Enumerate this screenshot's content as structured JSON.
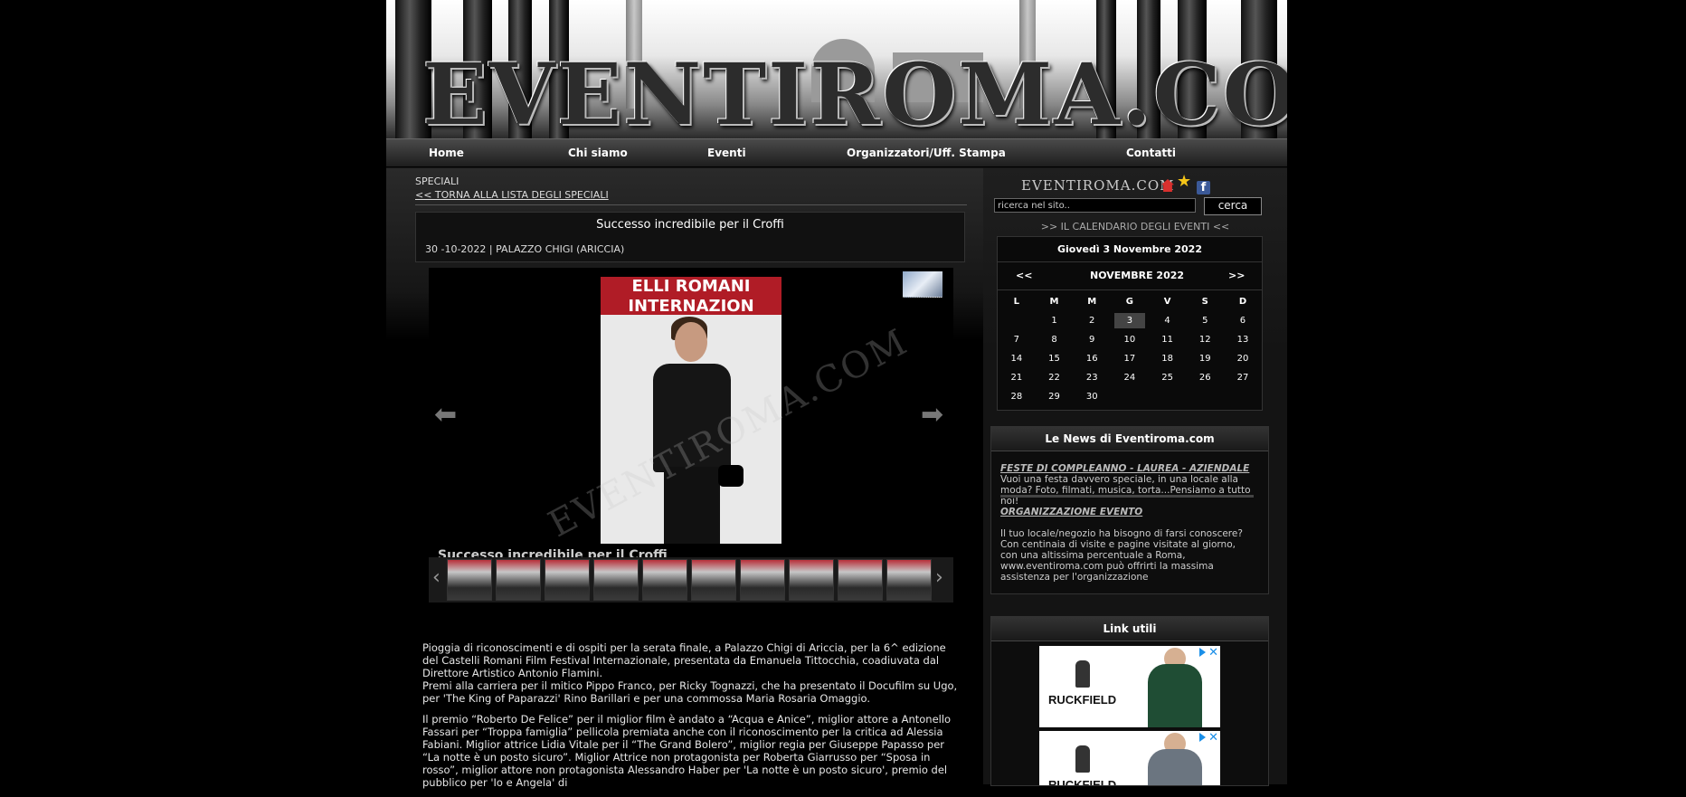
{
  "header": {
    "logo": "EVENTIROMA.COM"
  },
  "nav": {
    "items": [
      "Home",
      "Chi siamo",
      "Eventi",
      "Organizzatori/Uff. Stampa",
      "Contatti"
    ]
  },
  "main": {
    "section_label": "SPECIALI",
    "back_link": "<< TORNA ALLA LISTA DEGLI SPECIALI",
    "article_title": "Successo incredibile per il Croffi",
    "article_meta": "30 -10-2022  |  PALAZZO CHIGI (ARICCIA)",
    "gallery": {
      "banner": "ELLI ROMANI INTERNAZION",
      "watermark": "EVENTIROMA.COM",
      "caption": "Successo incredibile per il Croffi",
      "prev_arrow": "⬅",
      "next_arrow": "➡",
      "thumb_prev": "‹",
      "thumb_next": "›"
    },
    "body": {
      "p1": "Pioggia di riconoscimenti e di ospiti per la serata finale, a Palazzo Chigi di Ariccia, per la 6^ edizione del Castelli Romani Film Festival Internazionale, presentata da Emanuela Tittocchia, coadiuvata dal Direttore Artistico Antonio Flamini.",
      "p2": "Premi alla carriera per il mitico Pippo Franco, per Ricky Tognazzi, che ha presentato il Docufilm su Ugo, per 'The King of Paparazzi' Rino Barillari e per una commossa Maria Rosaria Omaggio.",
      "p3": "Il premio “Roberto De Felice” per il miglior film è andato a “Acqua e Anice”, miglior attore a Antonello Fassari per “Troppa famiglia” pellicola premiata anche con il riconoscimento per la critica ad Alessia Fabiani. Miglior attrice Lidia Vitale per il “The Grand Bolero”, miglior regia per Giuseppe Papasso per “La notte è un posto sicuro”. Miglior Attrice non protagonista per Roberta Giarrusso per “Sposa in rosso”, miglior attore non protagonista Alessandro Haber per 'La notte è un posto sicuro', premio del pubblico per 'Io e Angela' di"
    }
  },
  "sidebar": {
    "logo": "EVENTIROMA.COM",
    "search": {
      "placeholder": "ricerca nel sito..",
      "button": "cerca"
    },
    "calendar_link": ">> IL CALENDARIO DEGLI EVENTI <<",
    "calendar": {
      "current_date": "Giovedì 3 Novembre 2022",
      "prev": "<<",
      "next": ">>",
      "month": "NOVEMBRE 2022",
      "weekdays": [
        "L",
        "M",
        "M",
        "G",
        "V",
        "S",
        "D"
      ],
      "leading_blanks": 1,
      "days_in_month": 30,
      "today": 3
    },
    "news": {
      "title": "Le News di Eventiroma.com",
      "items": [
        {
          "title": "FESTE DI COMPLEANNO - LAUREA - AZIENDALE",
          "text": "Vuoi una festa davvero speciale, in una locale alla moda? Foto, filmati, musica, torta...Pensiamo a tutto noi!"
        },
        {
          "title": "ORGANIZZAZIONE EVENTO",
          "text": "Il tuo locale/negozio ha bisogno di farsi conoscere? Con centinaia di visite e pagine visitate al giorno, con una altissima percentuale a Roma, www.eventiroma.com può offrirti la massima assistenza per l'organizzazione"
        }
      ]
    },
    "links": {
      "title": "Link utili",
      "ads": [
        {
          "brand": "RUCKFIELD",
          "shirt_color": "#1f4d34"
        },
        {
          "brand": "RUCKFIELD",
          "shirt_color": "#6b7580"
        }
      ]
    }
  }
}
